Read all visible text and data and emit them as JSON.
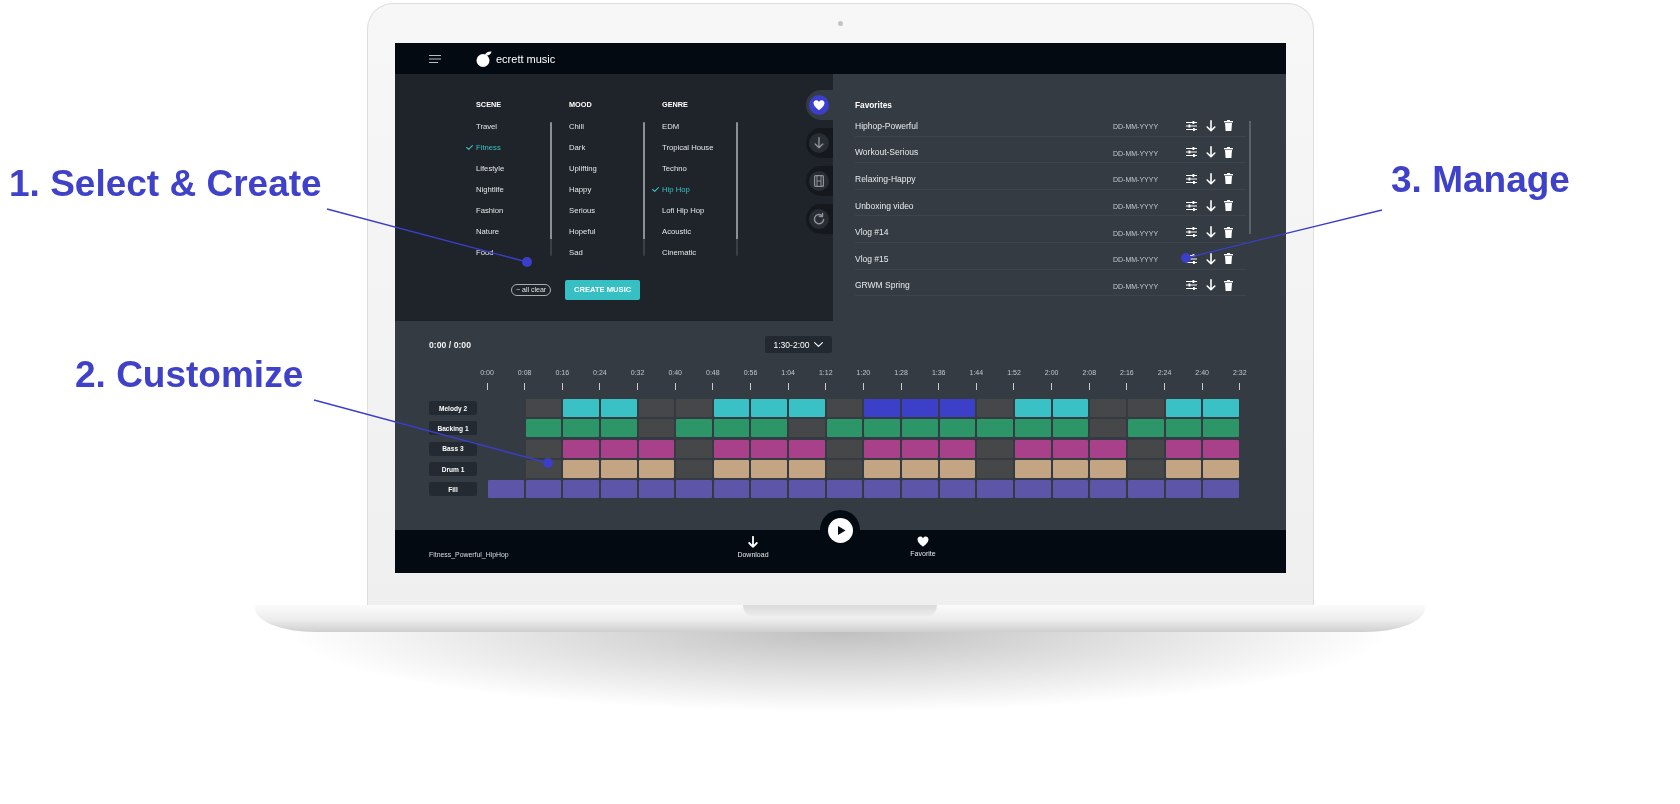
{
  "annotations": [
    {
      "text": "1. Select & Create"
    },
    {
      "text": "2. Customize"
    },
    {
      "text": "3. Manage"
    }
  ],
  "app": {
    "brand": "ecrett music",
    "filters": [
      {
        "title": "SCENE",
        "items": [
          {
            "label": "Travel",
            "selected": false
          },
          {
            "label": "Fitness",
            "selected": true
          },
          {
            "label": "Lifestyle",
            "selected": false
          },
          {
            "label": "Nightlife",
            "selected": false
          },
          {
            "label": "Fashion",
            "selected": false
          },
          {
            "label": "Nature",
            "selected": false
          },
          {
            "label": "Food",
            "selected": false
          }
        ]
      },
      {
        "title": "MOOD",
        "items": [
          {
            "label": "Chill",
            "selected": false
          },
          {
            "label": "Dark",
            "selected": false
          },
          {
            "label": "Uplifting",
            "selected": false
          },
          {
            "label": "Happy",
            "selected": false
          },
          {
            "label": "Serious",
            "selected": false
          },
          {
            "label": "Hopeful",
            "selected": false
          },
          {
            "label": "Sad",
            "selected": false
          }
        ]
      },
      {
        "title": "GENRE",
        "items": [
          {
            "label": "EDM",
            "selected": false
          },
          {
            "label": "Tropical House",
            "selected": false
          },
          {
            "label": "Techno",
            "selected": false
          },
          {
            "label": "Hip Hop",
            "selected": true
          },
          {
            "label": "Lofi Hip Hop",
            "selected": false
          },
          {
            "label": "Acoustic",
            "selected": false
          },
          {
            "label": "Cinematic",
            "selected": false
          }
        ]
      }
    ],
    "clear_button": "− all clear",
    "create_button": "CREATE MUSIC",
    "side_tabs": [
      {
        "kind": "heart",
        "selected": true
      },
      {
        "kind": "download",
        "selected": false
      },
      {
        "kind": "film",
        "selected": false
      },
      {
        "kind": "refresh",
        "selected": false
      }
    ],
    "favorites": {
      "title": "Favorites",
      "rows": [
        {
          "name": "Hiphop-Powerful",
          "date": "DD-MM-YYYY"
        },
        {
          "name": "Workout-Serious",
          "date": "DD-MM-YYYY"
        },
        {
          "name": "Relaxing-Happy",
          "date": "DD-MM-YYYY"
        },
        {
          "name": "Unboxing video",
          "date": "DD-MM-YYYY"
        },
        {
          "name": "Vlog #14",
          "date": "DD-MM-YYYY"
        },
        {
          "name": "Vlog #15",
          "date": "DD-MM-YYYY"
        },
        {
          "name": "GRWM Spring",
          "date": "DD-MM-YYYY"
        }
      ]
    },
    "player": {
      "time": "0:00 / 0:00",
      "range": "1:30-2:00",
      "ticks": [
        "0:00",
        "0:08",
        "0:16",
        "0:24",
        "0:32",
        "0:40",
        "0:48",
        "0:56",
        "1:04",
        "1:12",
        "1:20",
        "1:28",
        "1:36",
        "1:44",
        "1:52",
        "2:00",
        "2:08",
        "2:16",
        "2:24",
        "2:40",
        "2:32"
      ],
      "tracks": [
        {
          "name": "Melody 2",
          "cells": [
            {
              "kind": "gap"
            },
            {
              "kind": "empty"
            },
            {
              "kind": "clip",
              "color": "#39c1c6"
            },
            {
              "kind": "clip",
              "color": "#39c1c6"
            },
            {
              "kind": "empty"
            },
            {
              "kind": "empty"
            },
            {
              "kind": "clip",
              "color": "#39c1c6"
            },
            {
              "kind": "clip",
              "color": "#39c1c6"
            },
            {
              "kind": "clip",
              "color": "#39c1c6"
            },
            {
              "kind": "empty"
            },
            {
              "kind": "clip",
              "color": "#3c40c9"
            },
            {
              "kind": "clip",
              "color": "#3c40c9"
            },
            {
              "kind": "clip",
              "color": "#3c40c9"
            },
            {
              "kind": "empty"
            },
            {
              "kind": "clip",
              "color": "#39c1c6"
            },
            {
              "kind": "clip",
              "color": "#39c1c6"
            },
            {
              "kind": "empty"
            },
            {
              "kind": "empty"
            },
            {
              "kind": "clip",
              "color": "#39c1c6"
            },
            {
              "kind": "clip",
              "color": "#39c1c6"
            }
          ]
        },
        {
          "name": "Backing 1",
          "cells": [
            {
              "kind": "gap"
            },
            {
              "kind": "clip",
              "color": "#2d9669"
            },
            {
              "kind": "clip",
              "color": "#2d9669"
            },
            {
              "kind": "clip",
              "color": "#2d9669"
            },
            {
              "kind": "empty"
            },
            {
              "kind": "clip",
              "color": "#2d9669"
            },
            {
              "kind": "clip",
              "color": "#2d9669"
            },
            {
              "kind": "clip",
              "color": "#2d9669"
            },
            {
              "kind": "empty"
            },
            {
              "kind": "clip",
              "color": "#2d9669"
            },
            {
              "kind": "clip",
              "color": "#2d9669"
            },
            {
              "kind": "clip",
              "color": "#2d9669"
            },
            {
              "kind": "clip",
              "color": "#2d9669"
            },
            {
              "kind": "clip",
              "color": "#2d9669"
            },
            {
              "kind": "clip",
              "color": "#2d9669"
            },
            {
              "kind": "clip",
              "color": "#2d9669"
            },
            {
              "kind": "empty"
            },
            {
              "kind": "clip",
              "color": "#2d9669"
            },
            {
              "kind": "clip",
              "color": "#2d9669"
            },
            {
              "kind": "clip",
              "color": "#2d9669"
            }
          ]
        },
        {
          "name": "Bass 3",
          "cells": [
            {
              "kind": "gap"
            },
            {
              "kind": "empty"
            },
            {
              "kind": "clip",
              "color": "#a8408a"
            },
            {
              "kind": "clip",
              "color": "#a8408a"
            },
            {
              "kind": "clip",
              "color": "#a8408a"
            },
            {
              "kind": "empty"
            },
            {
              "kind": "clip",
              "color": "#a8408a"
            },
            {
              "kind": "clip",
              "color": "#a8408a"
            },
            {
              "kind": "clip",
              "color": "#a8408a"
            },
            {
              "kind": "empty"
            },
            {
              "kind": "clip",
              "color": "#a8408a"
            },
            {
              "kind": "clip",
              "color": "#a8408a"
            },
            {
              "kind": "clip",
              "color": "#a8408a"
            },
            {
              "kind": "empty"
            },
            {
              "kind": "clip",
              "color": "#a8408a"
            },
            {
              "kind": "clip",
              "color": "#a8408a"
            },
            {
              "kind": "clip",
              "color": "#a8408a"
            },
            {
              "kind": "empty"
            },
            {
              "kind": "clip",
              "color": "#a8408a"
            },
            {
              "kind": "clip",
              "color": "#a8408a"
            }
          ]
        },
        {
          "name": "Drum 1",
          "cells": [
            {
              "kind": "gap"
            },
            {
              "kind": "empty"
            },
            {
              "kind": "clip",
              "color": "#c4a583"
            },
            {
              "kind": "clip",
              "color": "#c4a583"
            },
            {
              "kind": "clip",
              "color": "#c4a583"
            },
            {
              "kind": "empty"
            },
            {
              "kind": "clip",
              "color": "#c4a583"
            },
            {
              "kind": "clip",
              "color": "#c4a583"
            },
            {
              "kind": "clip",
              "color": "#c4a583"
            },
            {
              "kind": "empty"
            },
            {
              "kind": "clip",
              "color": "#c4a583"
            },
            {
              "kind": "clip",
              "color": "#c4a583"
            },
            {
              "kind": "clip",
              "color": "#c4a583"
            },
            {
              "kind": "empty"
            },
            {
              "kind": "clip",
              "color": "#c4a583"
            },
            {
              "kind": "clip",
              "color": "#c4a583"
            },
            {
              "kind": "clip",
              "color": "#c4a583"
            },
            {
              "kind": "empty"
            },
            {
              "kind": "clip",
              "color": "#c4a583"
            },
            {
              "kind": "clip",
              "color": "#c4a583"
            }
          ]
        },
        {
          "name": "Fill",
          "cells": [
            {
              "kind": "clip",
              "color": "#5d55a8"
            },
            {
              "kind": "clip",
              "color": "#5d55a8"
            },
            {
              "kind": "clip",
              "color": "#5d55a8"
            },
            {
              "kind": "clip",
              "color": "#5d55a8"
            },
            {
              "kind": "clip",
              "color": "#5d55a8"
            },
            {
              "kind": "clip",
              "color": "#5d55a8"
            },
            {
              "kind": "clip",
              "color": "#5d55a8"
            },
            {
              "kind": "clip",
              "color": "#5d55a8"
            },
            {
              "kind": "clip",
              "color": "#5d55a8"
            },
            {
              "kind": "clip",
              "color": "#5d55a8"
            },
            {
              "kind": "clip",
              "color": "#5d55a8"
            },
            {
              "kind": "clip",
              "color": "#5d55a8"
            },
            {
              "kind": "clip",
              "color": "#5d55a8"
            },
            {
              "kind": "clip",
              "color": "#5d55a8"
            },
            {
              "kind": "clip",
              "color": "#5d55a8"
            },
            {
              "kind": "clip",
              "color": "#5d55a8"
            },
            {
              "kind": "clip",
              "color": "#5d55a8"
            },
            {
              "kind": "clip",
              "color": "#5d55a8"
            },
            {
              "kind": "clip",
              "color": "#5d55a8"
            },
            {
              "kind": "clip",
              "color": "#5d55a8"
            }
          ]
        }
      ]
    },
    "footer": {
      "filename": "Fitness_Powerful_HipHop",
      "actions": [
        {
          "kind": "download",
          "label": "Download"
        },
        {
          "kind": "favorite",
          "label": "Favorite"
        }
      ]
    }
  }
}
